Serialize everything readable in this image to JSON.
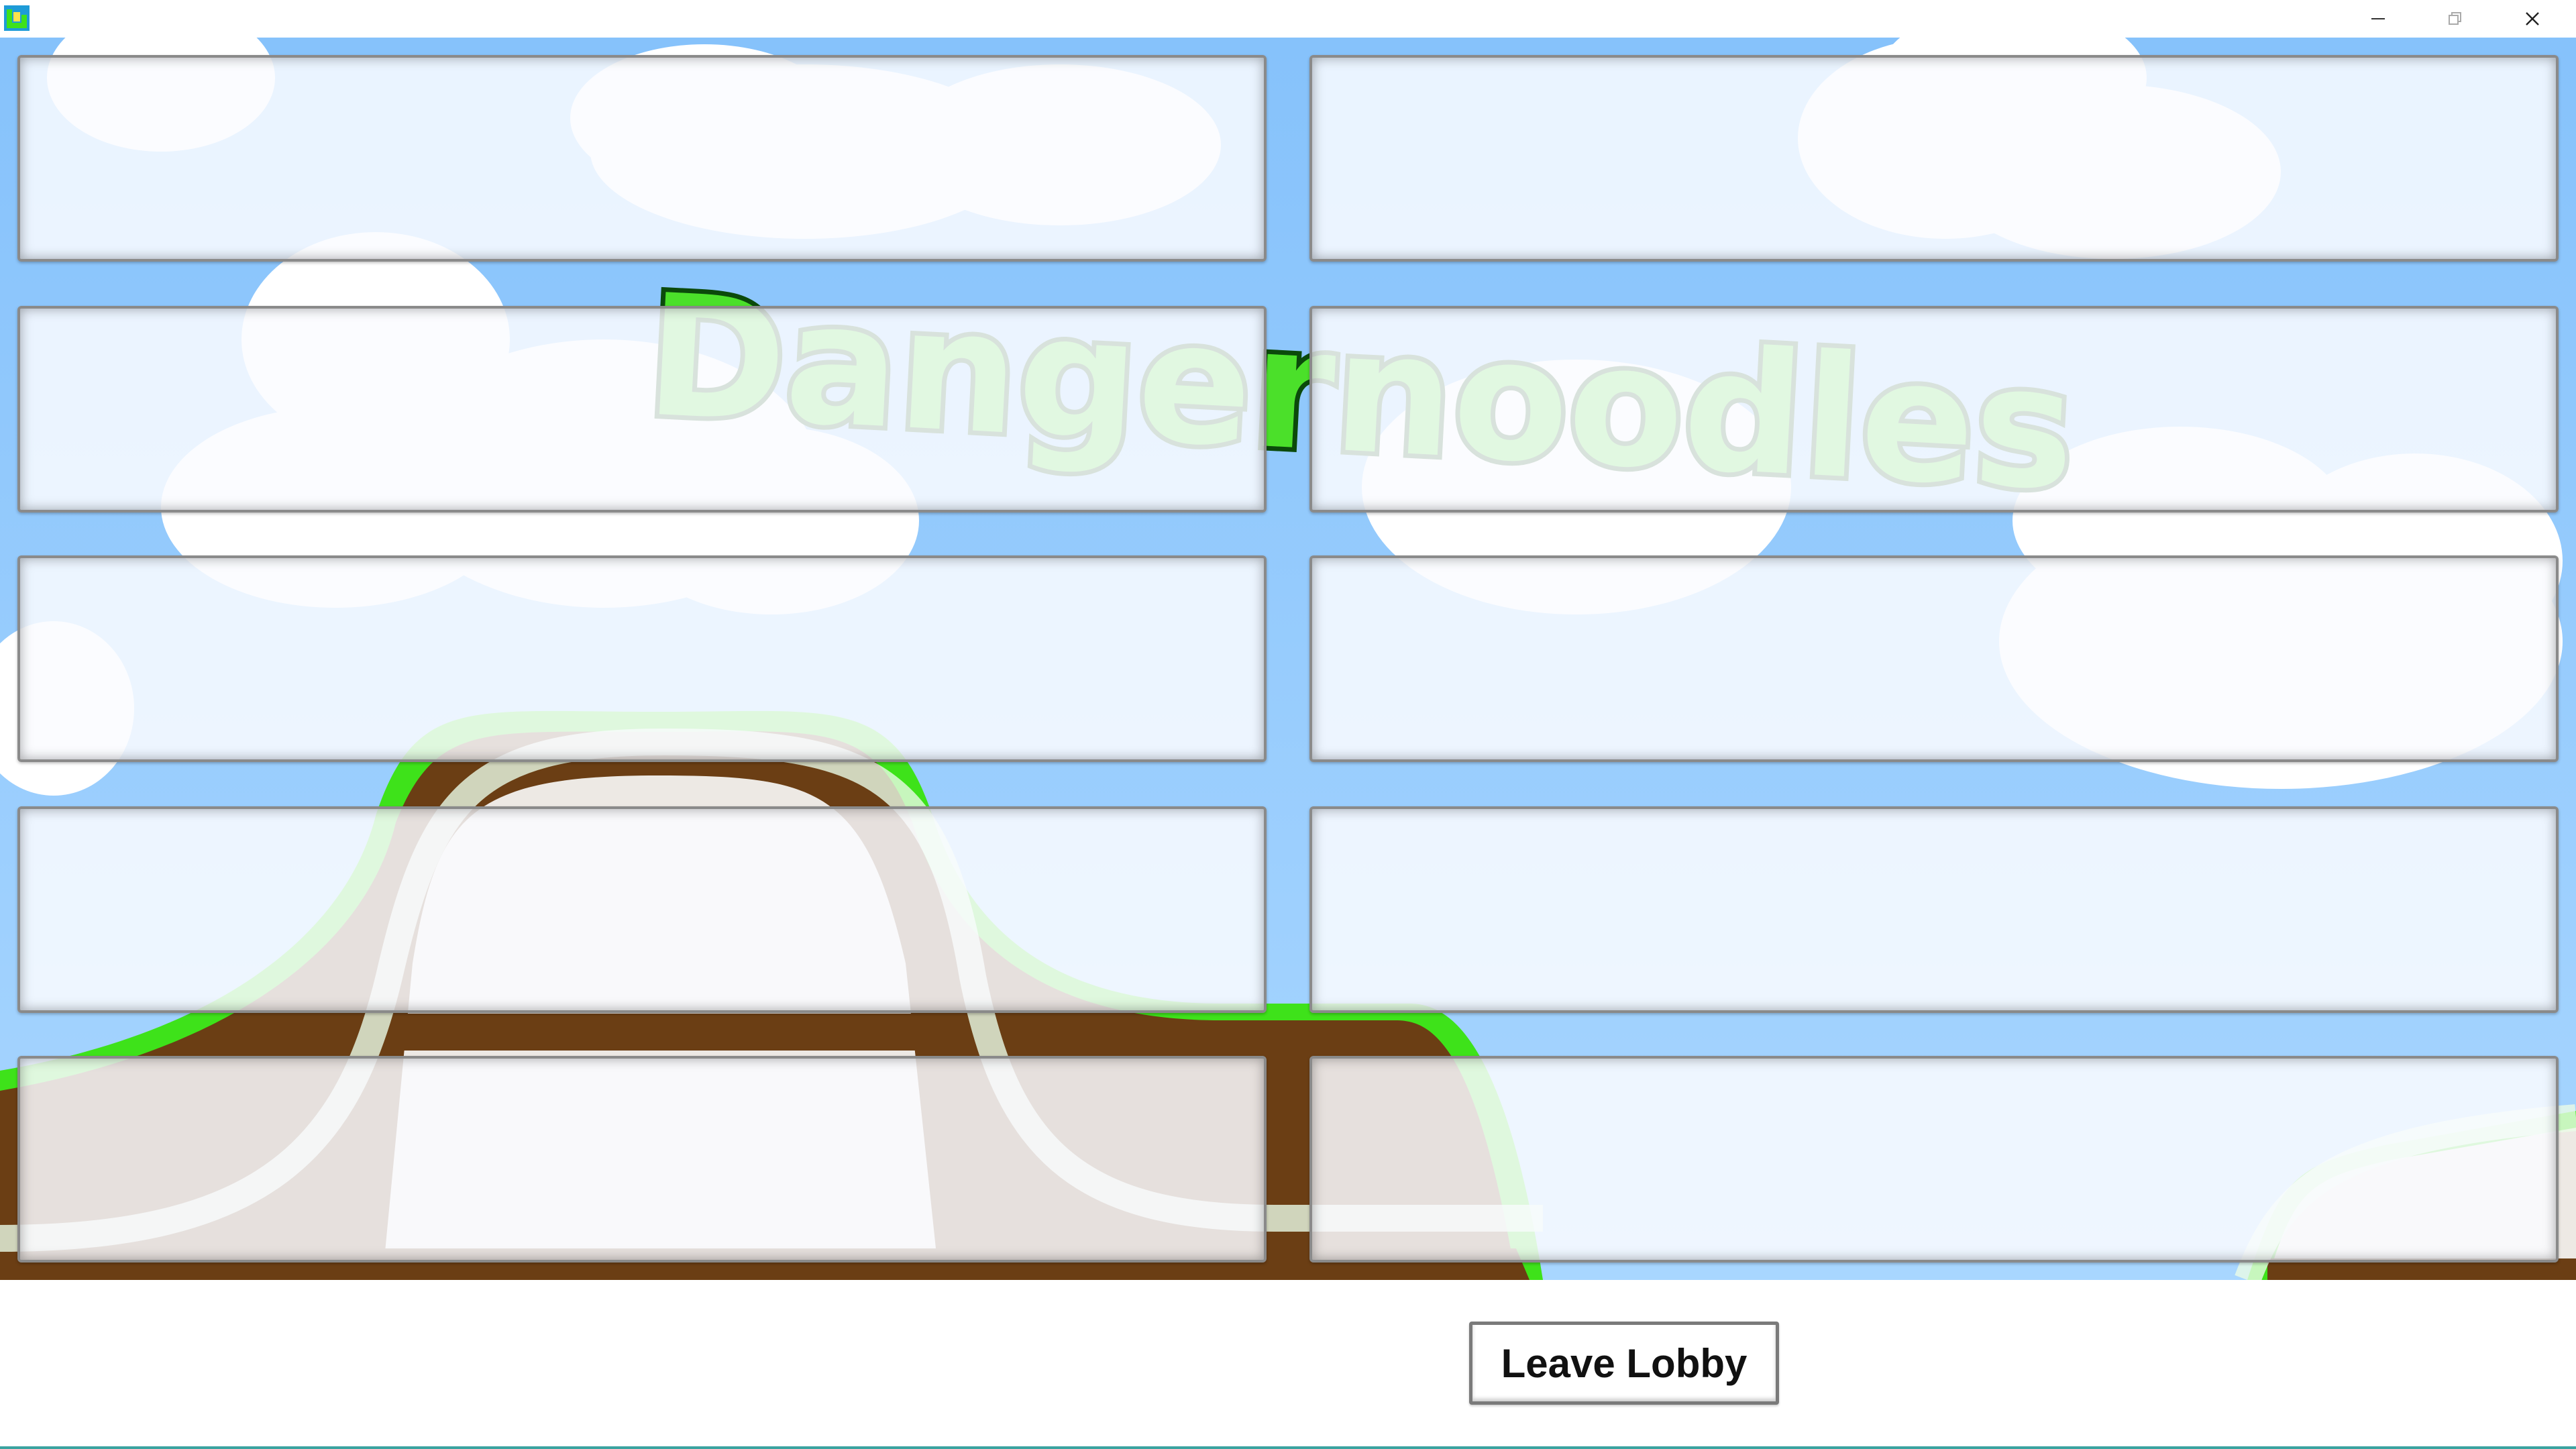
{
  "window": {
    "app_icon": "game-logo-icon",
    "controls": [
      "minimize-icon",
      "restore-icon",
      "close-icon"
    ]
  },
  "game": {
    "title": "Dangernoodles"
  },
  "lobby": {
    "slots": [
      {
        "name": ""
      },
      {
        "name": ""
      },
      {
        "name": ""
      },
      {
        "name": ""
      },
      {
        "name": ""
      },
      {
        "name": ""
      },
      {
        "name": ""
      },
      {
        "name": ""
      },
      {
        "name": ""
      },
      {
        "name": ""
      }
    ],
    "leave_label": "Leave Lobby"
  },
  "colors": {
    "sky": "#8fc8fb",
    "cloud": "#ffffff",
    "grass": "#3ee21a",
    "dirt": "#6b3e14",
    "rock": "#ede9e4",
    "title_fill": "#4be02a",
    "title_outline": "#0b4a0b",
    "bottom_accent": "#3ba3a0"
  }
}
